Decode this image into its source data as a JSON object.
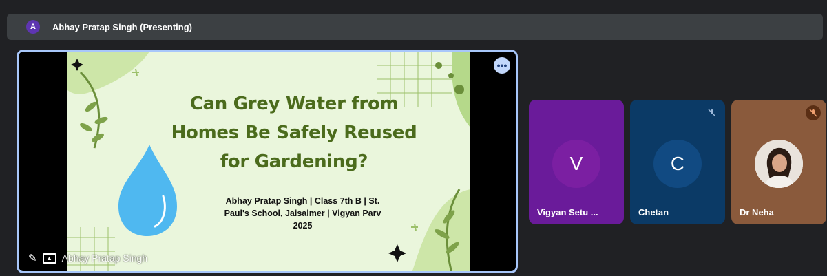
{
  "topbar": {
    "avatar_letter": "A",
    "presenting_label": "Abhay Pratap Singh (Presenting)"
  },
  "slide": {
    "title_lines": [
      "Can Grey Water from",
      "Homes Be Safely Reused",
      "for Gardening?"
    ],
    "subtitle_lines": [
      "Abhay Pratap Singh | Class 7th B | St.",
      "Paul's School, Jaisalmer | Vigyan Parv",
      "2025"
    ]
  },
  "main_tile": {
    "name": "Abhay Pratap Singh",
    "more_icon": "more-horiz-icon",
    "pin_icon": "pin-icon",
    "present_icon": "present-to-all-icon"
  },
  "participants": [
    {
      "name": "Vigyan Setu ...",
      "initial": "V",
      "tile_color": "#6a1b9a",
      "avatar_color": "#7b1fa2",
      "muted": false
    },
    {
      "name": "Chetan",
      "initial": "C",
      "tile_color": "#0b3a66",
      "avatar_color": "#114a82",
      "muted": true
    },
    {
      "name": "Dr Neha",
      "initial": "",
      "tile_color": "#8a5a3c",
      "avatar_color": "#e9e3dc",
      "muted": true
    }
  ],
  "colors": {
    "slide_bg": "#eaf6dc",
    "title_green": "#4b6b1c",
    "water_drop": "#4fb8f0",
    "focus_border": "#a8c7fa"
  }
}
